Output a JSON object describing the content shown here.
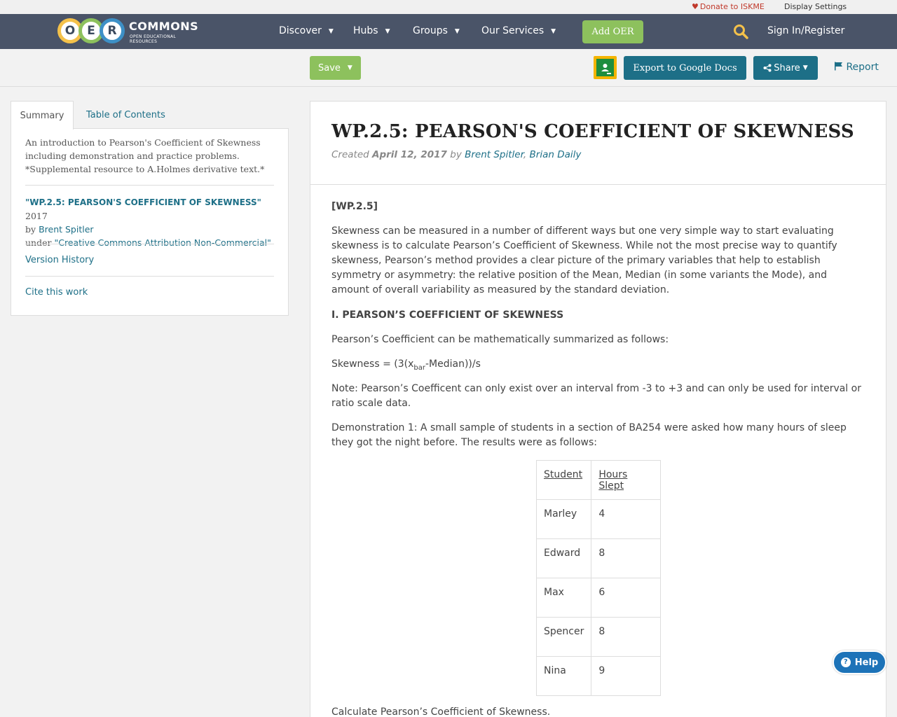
{
  "utility": {
    "donate": "Donate to ISKME",
    "display_settings": "Display Settings"
  },
  "brand": {
    "letters": [
      "O",
      "E",
      "R"
    ],
    "word": "COMMONS",
    "sub": "OPEN EDUCATIONAL RESOURCES"
  },
  "nav": {
    "items": [
      "Discover",
      "Hubs",
      "Groups",
      "Our Services"
    ],
    "add_oer": "Add OER",
    "sign_in": "Sign In/Register"
  },
  "actions": {
    "save": "Save",
    "export": "Export to Google Docs",
    "share": "Share",
    "report": "Report"
  },
  "sidebar": {
    "tabs": [
      "Summary",
      "Table of Contents"
    ],
    "description": "An introduction to Pearson's Coefficient of Skewness including demonstration and practice problems. *Supplemental resource to A.Holmes derivative text.*",
    "citation": {
      "title": "\"WP.2.5: PEARSON'S COEFFICIENT OF SKEWNESS\"",
      "year": "2017",
      "by": "by",
      "author": "Brent Spitler",
      "under": "under",
      "license": "\"Creative Commons Attribution Non-Commercial\""
    },
    "version_history": "Version History",
    "cite": "Cite this work"
  },
  "main": {
    "title": "WP.2.5: PEARSON'S COEFFICIENT OF SKEWNESS",
    "meta": {
      "created": "Created",
      "date": "April 12, 2017",
      "by": "by",
      "author1": "Brent Spitler",
      "sep": ",",
      "author2": "Brian Daily"
    },
    "tag": "[WP.2.5]",
    "intro": "Skewness can be measured in a number of different ways but one very simple way to start evaluating skewness is to calculate Pearson’s Coefficient of Skewness.  While not the most precise way to quantify skewness, Pearson’s method provides a clear picture of the primary variables that help to establish symmetry or asymmetry: the relative position of the Mean, Median (in some variants the Mode), and amount of overall variability as measured by the standard deviation.",
    "section_heading": "I. PEARSON’S COEFFICIENT OF SKEWNESS",
    "summary_line": "Pearson’s Coefficient can be mathematically summarized as follows:",
    "formula_pre": "Skewness = (3(x",
    "formula_sub": "bar",
    "formula_post": "-Median))/s",
    "note": "Note: Pearson’s Coefficent can only exist over an interval from -3 to +3 and can only be used for interval or ratio scale data.",
    "demo": "Demonstration 1:  A small sample of students in a section of BA254 were asked how many hours of sleep they got the night before.  The results were as follows:",
    "table": {
      "headers": [
        "Student",
        "Hours Slept"
      ],
      "rows": [
        [
          "Marley",
          "4"
        ],
        [
          "Edward",
          "8"
        ],
        [
          "Max",
          "6"
        ],
        [
          "Spencer",
          "8"
        ],
        [
          "Nina",
          "9"
        ]
      ]
    },
    "calculate": "Calculate Pearson’s Coefficient of Skewness."
  },
  "help": "Help",
  "colors": {
    "navbar": "#4a5468",
    "green": "#8dc15d",
    "teal": "#1d6f87",
    "help_blue": "#1d73b8"
  }
}
